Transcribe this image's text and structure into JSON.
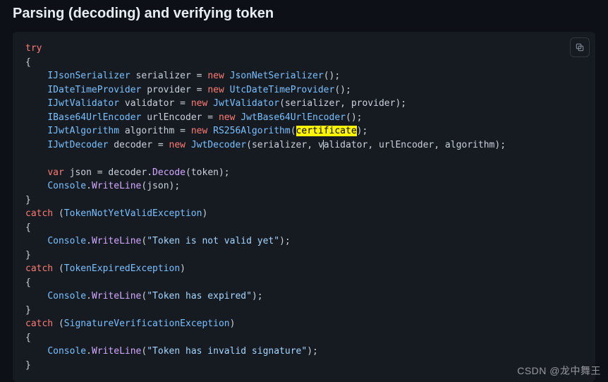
{
  "heading": "Parsing (decoding) and verifying token",
  "watermark": "CSDN @龙中舞王",
  "code": {
    "kw_try": "try",
    "kw_catch": "catch",
    "kw_new": "new",
    "kw_var": "var",
    "t_IJsonSerializer": "IJsonSerializer",
    "t_JsonNetSerializer": "JsonNetSerializer",
    "t_IDateTimeProvider": "IDateTimeProvider",
    "t_UtcDateTimeProvider": "UtcDateTimeProvider",
    "t_IJwtValidator": "IJwtValidator",
    "t_JwtValidator": "JwtValidator",
    "t_IBase64UrlEncoder": "IBase64UrlEncoder",
    "t_JwtBase64UrlEncoder": "JwtBase64UrlEncoder",
    "t_IJwtAlgorithm": "IJwtAlgorithm",
    "t_RS256Algorithm": "RS256Algorithm",
    "t_IJwtDecoder": "IJwtDecoder",
    "t_JwtDecoder": "JwtDecoder",
    "t_Console": "Console",
    "t_TokenNotYetValidException": "TokenNotYetValidException",
    "t_TokenExpiredException": "TokenExpiredException",
    "t_SignatureVerificationException": "SignatureVerificationException",
    "v_serializer": "serializer",
    "v_provider": "provider",
    "v_validator": "validator",
    "v_urlEncoder": "urlEncoder",
    "v_algorithm": "algorithm",
    "v_certificate": "certificate",
    "v_decoder": "decoder",
    "v_json": "json",
    "v_token": "token",
    "m_Decode": "Decode",
    "m_WriteLine": "WriteLine",
    "s_notvalid": "\"Token is not valid yet\"",
    "s_expired": "\"Token has expired\"",
    "s_invalidsig": "\"Token has invalid signature\""
  }
}
